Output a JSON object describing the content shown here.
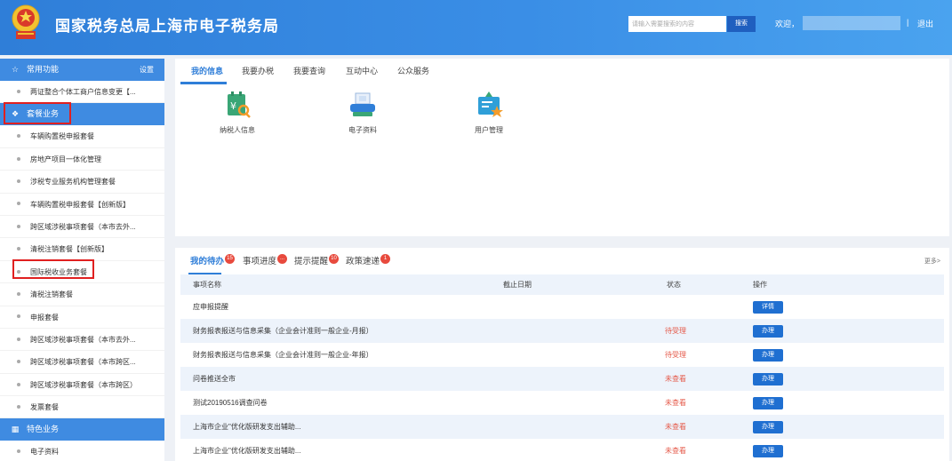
{
  "header": {
    "site_title": "国家税务总局上海市电子税务局",
    "search_placeholder": "请输入需要搜索的内容",
    "search_button": "搜索",
    "welcome": "欢迎，",
    "separator": "|",
    "logout": "退出",
    "logo_icon": "tax-emblem-icon"
  },
  "sidebar": {
    "common": {
      "title": "常用功能",
      "setting": "设置",
      "icon": "star-icon"
    },
    "common_items": [
      "两证整合个体工商户信息变更【..."
    ],
    "package": {
      "title": "套餐业务",
      "icon": "layers-icon"
    },
    "package_items": [
      "车辆购置税申报套餐",
      "房地产项目一体化管理",
      "涉税专业服务机构管理套餐",
      "车辆购置税申报套餐【创新版】",
      "跨区域涉税事项套餐（本市去外...",
      "清税注销套餐【创新版】",
      "国际税收业务套餐",
      "清税注销套餐",
      "申报套餐",
      "跨区域涉税事项套餐（本市去外...",
      "跨区域涉税事项套餐（本市跨区...",
      "跨区域涉税事项套餐（本市跨区）",
      "发票套餐"
    ],
    "featured": {
      "title": "特色业务",
      "icon": "grid-icon"
    },
    "featured_items": [
      "电子资料"
    ]
  },
  "top_panel": {
    "tabs": [
      "我的信息",
      "我要办税",
      "我要查询",
      "互动中心",
      "公众服务"
    ],
    "active_tab": 0,
    "shortcuts": [
      {
        "label": "纳税人信息",
        "icon": "taxpayer-info-icon"
      },
      {
        "label": "电子资料",
        "icon": "electronic-docs-icon"
      },
      {
        "label": "用户管理",
        "icon": "user-management-icon"
      }
    ]
  },
  "bottom_panel": {
    "tabs": [
      {
        "label": "我的待办",
        "badge": "15"
      },
      {
        "label": "事项进度",
        "badge": "..."
      },
      {
        "label": "提示提醒",
        "badge": "10"
      },
      {
        "label": "政策速递",
        "badge": "1"
      }
    ],
    "more": "更多>",
    "columns": [
      "事项名称",
      "截止日期",
      "状态",
      "操作"
    ],
    "rows": [
      {
        "name": "应申报提醒",
        "deadline": "",
        "status": "",
        "action": "详情"
      },
      {
        "name": "财务报表报送与信息采集（企业会计准则一般企业-月报）",
        "deadline": "",
        "status": "待受理",
        "action": "办理"
      },
      {
        "name": "财务报表报送与信息采集（企业会计准则一般企业-年报）",
        "deadline": "",
        "status": "待受理",
        "action": "办理"
      },
      {
        "name": "问卷推送全市",
        "deadline": "",
        "status": "未查看",
        "action": "办理"
      },
      {
        "name": "测试20190516调查问卷",
        "deadline": "",
        "status": "未查看",
        "action": "办理"
      },
      {
        "name": "上海市企业\"优化版研发支出辅助...",
        "deadline": "",
        "status": "未查看",
        "action": "办理"
      },
      {
        "name": "上海市企业\"优化版研发支出辅助...",
        "deadline": "",
        "status": "未查看",
        "action": "办理"
      }
    ]
  },
  "colors": {
    "header_blue": "#3a8ee6",
    "accent_blue": "#2f7ed8",
    "badge_red": "#e84a3d",
    "status_red": "#e55a4a",
    "highlight_box": "#e02020"
  }
}
